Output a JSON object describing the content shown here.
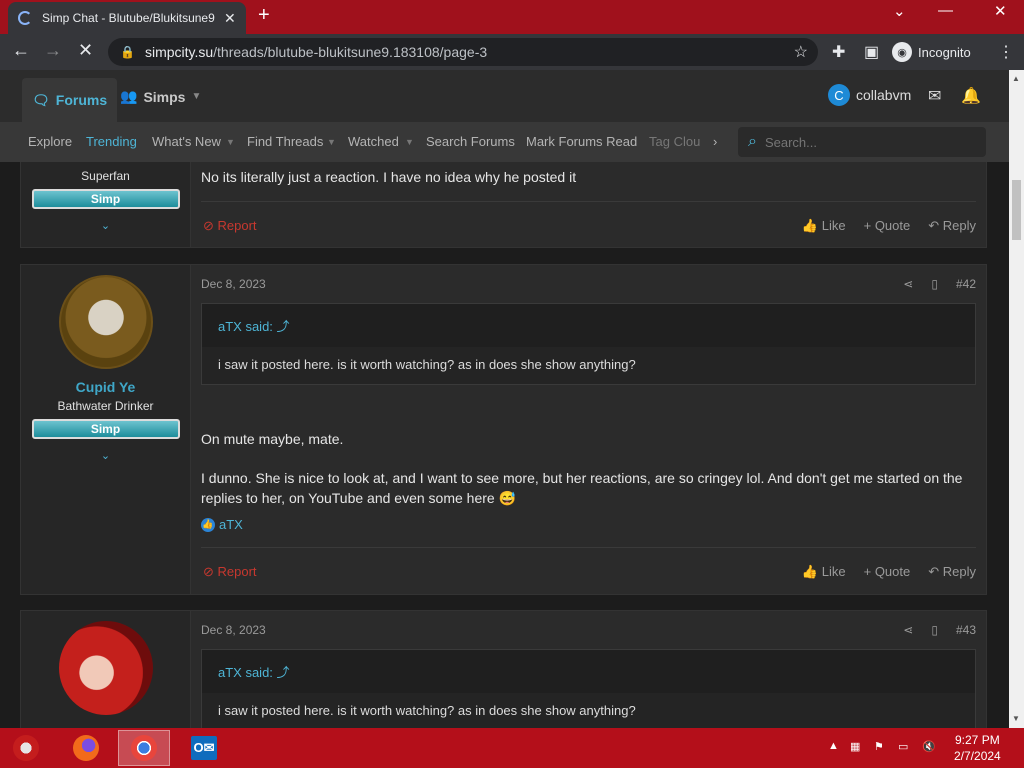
{
  "browser": {
    "tab_title": "Simp Chat - Blutube/Blukitsune9",
    "url_domain": "simpcity.su",
    "url_path": "/threads/blutube-blukitsune9.183108/page-3",
    "incognito_label": "Incognito"
  },
  "site": {
    "nav_forums": "Forums",
    "nav_simps": "Simps",
    "username": "collabvm",
    "user_initial": "C",
    "subnav": [
      "Explore",
      "Trending",
      "What's New",
      "Find Threads",
      "Watched",
      "Search Forums",
      "Mark Forums Read",
      "Tag Clou"
    ],
    "search_placeholder": "Search..."
  },
  "posts": [
    {
      "user_title": "Superfan",
      "banner": "Simp",
      "message": "No its literally just a reaction. I have no idea why he posted it",
      "report": "Report",
      "like": "Like",
      "quote": "Quote",
      "reply": "Reply"
    },
    {
      "username": "Cupid Ye",
      "user_title": "Bathwater Drinker",
      "banner": "Simp",
      "date": "Dec 8, 2023",
      "number": "#42",
      "quote_author": "aTX said:",
      "quote_text": "i saw it posted here. is it worth watching? as in does she show anything?",
      "message_1": "On mute maybe, mate.",
      "message_2": "I dunno. She is nice to look at, and I want to see more, but her reactions, are so cringey lol. And don't get me started on the replies to her, on YouTube and even some here 😅",
      "reaction_user": "aTX",
      "report": "Report",
      "like": "Like",
      "quote": "Quote",
      "reply": "Reply"
    },
    {
      "date": "Dec 8, 2023",
      "number": "#43",
      "quote_author": "aTX said:",
      "quote_text": "i saw it posted here. is it worth watching? as in does she show anything?"
    }
  ],
  "taskbar": {
    "time": "9:27 PM",
    "date": "2/7/2024"
  }
}
